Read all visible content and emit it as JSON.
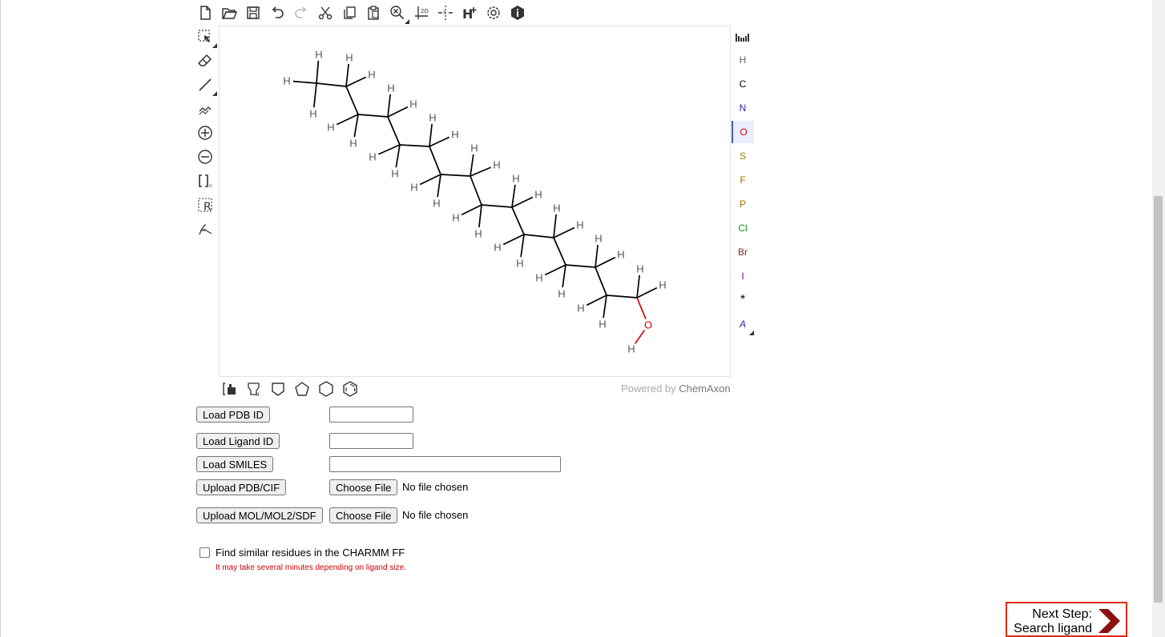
{
  "toolbar": {
    "top_icons": [
      "new-document-icon",
      "open-folder-icon",
      "save-icon",
      "undo-icon",
      "redo-icon",
      "cut-icon",
      "copy-icon",
      "paste-icon",
      "zoom-icon",
      "clean-2d-icon",
      "explicit-stereo-icon",
      "add-explicit-hydrogens-icon",
      "settings-gear-icon",
      "info-icon"
    ],
    "left_icons": [
      "selection-icon",
      "eraser-icon",
      "single-bond-icon",
      "chain-icon",
      "increase-charge-icon",
      "decrease-charge-icon",
      "sgroup-bracket-icon",
      "r-group-icon",
      "reaction-arrow-icon"
    ],
    "bottom_icons": [
      "template-library-icon",
      "template-group-icon",
      "cyclopropane-icon",
      "cyclopentane-icon",
      "cyclohexane-icon",
      "benzene-icon"
    ]
  },
  "element_panel": {
    "elements": [
      {
        "symbol": "H",
        "color": "#666666"
      },
      {
        "symbol": "C",
        "color": "#000000"
      },
      {
        "symbol": "N",
        "color": "#2a2aaa"
      },
      {
        "symbol": "O",
        "color": "#d8000c",
        "selected": true
      },
      {
        "symbol": "S",
        "color": "#8a8a00"
      },
      {
        "symbol": "F",
        "color": "#a07000"
      },
      {
        "symbol": "P",
        "color": "#a07000"
      },
      {
        "symbol": "Cl",
        "color": "#1a8a1a"
      },
      {
        "symbol": "Br",
        "color": "#7a2a2a"
      },
      {
        "symbol": "I",
        "color": "#7a00a0"
      },
      {
        "symbol": "*",
        "color": "#000000"
      },
      {
        "symbol": "A",
        "color": "#2a2aaa"
      }
    ]
  },
  "molecule": {
    "atom_symbols": {
      "hydrogen": "H",
      "oxygen": "O"
    },
    "colors": {
      "bond": "#000000",
      "hydrogen": "#555555",
      "oxygen": "#d8000c"
    }
  },
  "powered_by": {
    "prefix": "Powered by ",
    "brand": "ChemAxon"
  },
  "form": {
    "load_pdb_label": "Load PDB ID",
    "load_ligand_label": "Load Ligand ID",
    "load_smiles_label": "Load SMILES",
    "upload_pdb_label": "Upload PDB/CIF",
    "upload_mol_label": "Upload MOL/MOL2/SDF",
    "choose_file_label": "Choose File",
    "no_file_text": "No file chosen",
    "pdb_id_value": "",
    "ligand_id_value": "",
    "smiles_value": "",
    "similar_checkbox_label": "Find similar residues in the CHARMM FF",
    "similar_checked": false,
    "warning_text": "It may take several minutes depending on ligand size."
  },
  "next_step": {
    "line1": "Next Step:",
    "line2": "Search ligand",
    "accent": "#e02a12",
    "arrow_color": "#8b1010"
  }
}
